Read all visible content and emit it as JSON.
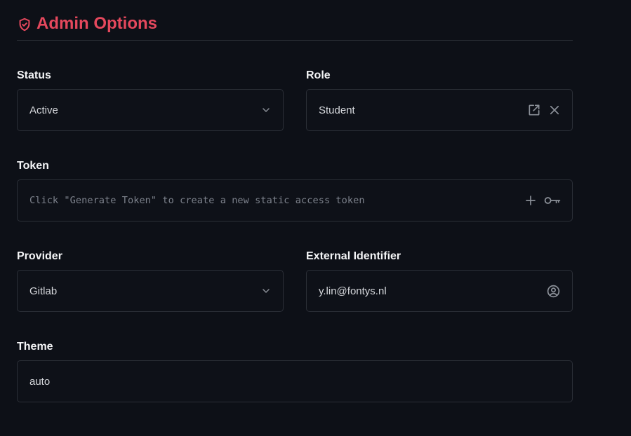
{
  "header": {
    "title": "Admin Options",
    "icon": "shield-check-icon",
    "accent_color": "#e5485d"
  },
  "fields": {
    "status": {
      "label": "Status",
      "value": "Active",
      "icon": "chevron-down-icon"
    },
    "role": {
      "label": "Role",
      "value": "Student",
      "icons": [
        "external-link-icon",
        "close-icon"
      ]
    },
    "token": {
      "label": "Token",
      "placeholder": "Click \"Generate Token\" to create a new static access token",
      "icons": [
        "plus-icon",
        "key-icon"
      ]
    },
    "provider": {
      "label": "Provider",
      "value": "Gitlab",
      "icon": "chevron-down-icon"
    },
    "external_identifier": {
      "label": "External Identifier",
      "value": "y.lin@fontys.nl",
      "icon": "user-circle-icon"
    },
    "theme": {
      "label": "Theme",
      "value": "auto"
    }
  }
}
